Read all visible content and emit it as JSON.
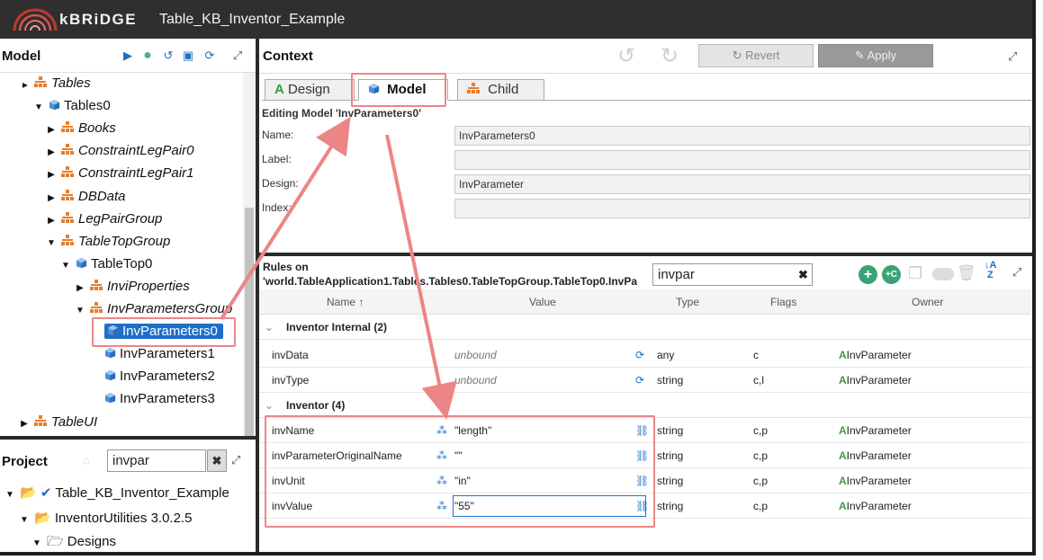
{
  "app": {
    "brand": "kBRiDGE",
    "title": "Table_KB_Inventor_Example"
  },
  "model_pane": {
    "title": "Model",
    "tree": [
      {
        "label": "Tables",
        "icon": "org",
        "italic": true,
        "arrow": "▲"
      },
      {
        "label": "Tables0",
        "icon": "cube",
        "italic": false,
        "arrow": "▼"
      },
      {
        "label": "Books",
        "icon": "org",
        "italic": true,
        "arrow": "▶"
      },
      {
        "label": "ConstraintLegPair0",
        "icon": "org",
        "italic": true,
        "arrow": "▶"
      },
      {
        "label": "ConstraintLegPair1",
        "icon": "org",
        "italic": true,
        "arrow": "▶"
      },
      {
        "label": "DBData",
        "icon": "org",
        "italic": true,
        "arrow": "▶"
      },
      {
        "label": "LegPairGroup",
        "icon": "org",
        "italic": true,
        "arrow": "▶"
      },
      {
        "label": "TableTopGroup",
        "icon": "org",
        "italic": true,
        "arrow": "▼"
      },
      {
        "label": "TableTop0",
        "icon": "cube",
        "italic": false,
        "arrow": "▼"
      },
      {
        "label": "InviProperties",
        "icon": "org",
        "italic": true,
        "arrow": "▶"
      },
      {
        "label": "InvParametersGroup",
        "icon": "org",
        "italic": true,
        "arrow": "▼"
      },
      {
        "label": "InvParameters0",
        "icon": "cube",
        "italic": false,
        "arrow": "",
        "selected": true
      },
      {
        "label": "InvParameters1",
        "icon": "cube",
        "italic": false,
        "arrow": ""
      },
      {
        "label": "InvParameters2",
        "icon": "cube",
        "italic": false,
        "arrow": ""
      },
      {
        "label": "InvParameters3",
        "icon": "cube",
        "italic": false,
        "arrow": ""
      },
      {
        "label": "TableUI",
        "icon": "org",
        "italic": true,
        "arrow": "▶"
      }
    ]
  },
  "project_pane": {
    "title": "Project",
    "filter_value": "invpar",
    "tree": [
      {
        "label": "Table_KB_Inventor_Example"
      },
      {
        "label": "InventorUtilities 3.0.2.5"
      },
      {
        "label": "Designs"
      }
    ]
  },
  "context_pane": {
    "title": "Context",
    "revert_label": "Revert",
    "apply_label": "Apply",
    "tabs": [
      {
        "label": "Design"
      },
      {
        "label": "Model"
      },
      {
        "label": "Child"
      }
    ],
    "editing_label": "Editing Model 'InvParameters0'",
    "fields": [
      {
        "label": "Name:",
        "value": "InvParameters0"
      },
      {
        "label": "Label:",
        "value": ""
      },
      {
        "label": "Design:",
        "value": "InvParameter"
      },
      {
        "label": "Index:",
        "value": ""
      }
    ]
  },
  "rules_pane": {
    "title_line1": "Rules on",
    "title_line2": "'world.TableApplication1.Tables.Tables0.TableTopGroup.TableTop0.InvPa",
    "search_value": "invpar",
    "columns": {
      "name": "Name ↑",
      "value": "Value",
      "type": "Type",
      "flags": "Flags",
      "owner": "Owner"
    },
    "groups": [
      {
        "label": "Inventor Internal (2)"
      },
      {
        "label": "Inventor (4)"
      }
    ],
    "rows": [
      {
        "name": "invData",
        "value": "unbound",
        "type": "any",
        "flags": "c",
        "owner": "InvParameter"
      },
      {
        "name": "invType",
        "value": "unbound",
        "type": "string",
        "flags": "c,l",
        "owner": "InvParameter"
      },
      {
        "name": "invName",
        "value": "\"length\"",
        "type": "string",
        "flags": "c,p",
        "owner": "InvParameter"
      },
      {
        "name": "invParameterOriginalName",
        "value": "\"\"",
        "type": "string",
        "flags": "c,p",
        "owner": "InvParameter"
      },
      {
        "name": "invUnit",
        "value": "\"in\"",
        "type": "string",
        "flags": "c,p",
        "owner": "InvParameter"
      },
      {
        "name": "invValue",
        "value": "\"55\"",
        "type": "string",
        "flags": "c,p",
        "owner": "InvParameter"
      }
    ]
  },
  "colors": {
    "accent": "#1e6ec8",
    "annotation": "#ec8585",
    "org_icon": "#e87d2a",
    "green": "#3a9e3a"
  }
}
